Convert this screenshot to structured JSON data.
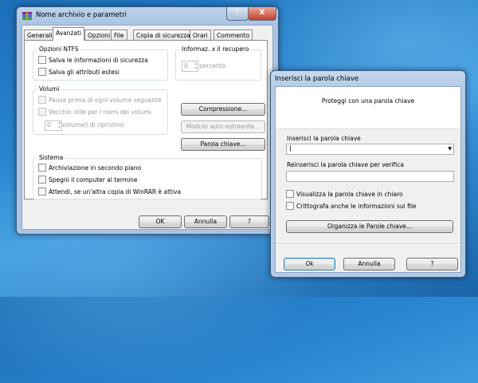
{
  "winrar_dialog": {
    "title": "Nome archivio e parametri",
    "title_buttons": {
      "help": "?",
      "close": "X"
    },
    "tabs": [
      "Generali",
      "Avanzati",
      "Opzioni",
      "File",
      "Copia di sicurezza",
      "Orari",
      "Commento"
    ],
    "active_tab": "Avanzati",
    "ntfs": {
      "title": "Opzioni NTFS",
      "options": [
        "Salva le informazioni di sicurezza",
        "Salva gli attributi estesi"
      ]
    },
    "recovery": {
      "title": "Informaz. x il recupero",
      "value": "0",
      "unit": "percento"
    },
    "volumes": {
      "title": "Volumi",
      "options": [
        "Pausa prima di ogni volume seguente",
        "Vecchio stile per i nomi dei volumi"
      ],
      "spin_value": "0",
      "spin_label": "volume/i di ripristino"
    },
    "side_buttons": {
      "compression": "Compressione...",
      "sfx": "Modulo auto-estraente...",
      "password": "Parola chiave..."
    },
    "system": {
      "title": "Sistema",
      "options": [
        "Archiviazione in secondo piano",
        "Spegni il computer al termine",
        "Attendi, se un'altra copia di WinRAR è attiva"
      ]
    },
    "footer": {
      "ok": "OK",
      "cancel": "Annulla",
      "help": "?"
    }
  },
  "password_dialog": {
    "title": "Inserisci la parola chiave",
    "header": "Proteggi con una parola chiave",
    "password_label": "Inserisci la parola chiave",
    "password_value": "|",
    "verify_label": "Reinserisci la parola chiave per verifica",
    "verify_value": "",
    "options": [
      "Visualizza la parola chiave in chiaro",
      "Crittografa anche le informazioni sui file"
    ],
    "organize_button": "Organizza le Parole chiave...",
    "footer": {
      "ok": "Ok",
      "cancel": "Annulla",
      "help": "?"
    }
  },
  "icons": {
    "winrar": "winrar-books-icon",
    "dropdown": "chevron-down-icon"
  }
}
